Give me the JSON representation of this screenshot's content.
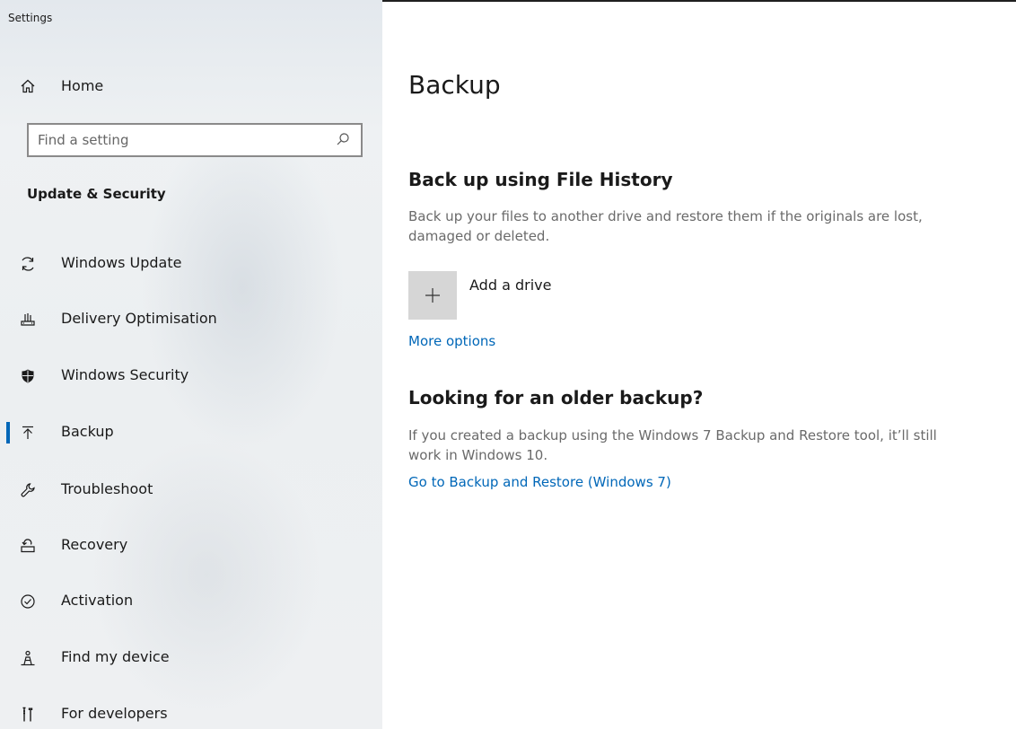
{
  "window": {
    "title": "Settings"
  },
  "sidebar": {
    "home": {
      "label": "Home",
      "icon": "home-icon"
    },
    "search": {
      "placeholder": "Find a setting",
      "value": "",
      "icon": "search-icon"
    },
    "section_title": "Update & Security",
    "items": [
      {
        "label": "Windows Update",
        "icon": "sync-icon",
        "selected": false
      },
      {
        "label": "Delivery Optimisation",
        "icon": "delivery-optimisation-icon",
        "selected": false
      },
      {
        "label": "Windows Security",
        "icon": "shield-icon",
        "selected": false
      },
      {
        "label": "Backup",
        "icon": "upload-icon",
        "selected": true
      },
      {
        "label": "Troubleshoot",
        "icon": "wrench-icon",
        "selected": false
      },
      {
        "label": "Recovery",
        "icon": "recovery-icon",
        "selected": false
      },
      {
        "label": "Activation",
        "icon": "check-circle-icon",
        "selected": false
      },
      {
        "label": "Find my device",
        "icon": "person-location-icon",
        "selected": false
      },
      {
        "label": "For developers",
        "icon": "developer-tools-icon",
        "selected": false
      }
    ]
  },
  "main": {
    "title": "Backup",
    "file_history": {
      "heading": "Back up using File History",
      "description": "Back up your files to another drive and restore them if the originals are lost, damaged or deleted.",
      "add_drive_label": "Add a drive",
      "more_options_label": "More options"
    },
    "older_backup": {
      "heading": "Looking for an older backup?",
      "description": "If you created a backup using the Windows 7 Backup and Restore tool, it’ll still work in Windows 10.",
      "link_label": "Go to Backup and Restore (Windows 7)"
    }
  },
  "colors": {
    "accent": "#0067b8",
    "secondary_text": "#6a6a6a",
    "tile": "#d6d6d6"
  }
}
